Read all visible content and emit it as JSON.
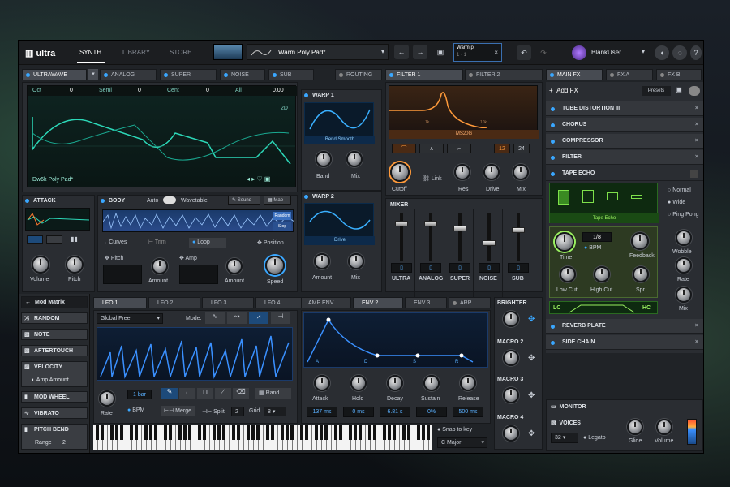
{
  "top": {
    "nav": [
      "SYNTH",
      "LIBRARY",
      "STORE"
    ],
    "preset": "Warm Poly Pad*",
    "ab_line1": "Warm p",
    "ab_line2": "1 · 1",
    "ab_close": "×",
    "user": "BlankUser"
  },
  "osc": {
    "tabs": [
      "ULTRAWAVE",
      "ANALOG",
      "SUPER",
      "NOISE",
      "SUB"
    ],
    "routing": "ROUTING",
    "params": [
      {
        "name": "Oct",
        "value": "0"
      },
      {
        "name": "Semi",
        "value": "0"
      },
      {
        "name": "Cent",
        "value": "0"
      },
      {
        "name": "All",
        "value": "0.00"
      }
    ],
    "mode": "2D",
    "table": "Dw6k Poly Pad*"
  },
  "warp1": {
    "title": "WARP 1",
    "mode": "Bend Smooth",
    "knobs": [
      "Band",
      "Mix"
    ]
  },
  "warp2": {
    "title": "WARP 2",
    "mode": "Drive",
    "knobs": [
      "Amount",
      "Mix"
    ]
  },
  "attack": {
    "title": "ATTACK",
    "knobs": [
      "Volume",
      "Pitch"
    ]
  },
  "body": {
    "title": "BODY",
    "auto": "Auto",
    "wavetable": "Wavetable",
    "sound": "Sound",
    "map": "Map",
    "tabs": [
      "Curves",
      "Trim",
      "Loop"
    ],
    "position": "Position",
    "pitch": "Pitch",
    "amp": "Amp",
    "amount1": "Amount",
    "amount2": "Amount",
    "speed": "Speed",
    "random": "Random",
    "stop": "Stop"
  },
  "filter": {
    "tabs": [
      "FILTER 1",
      "FILTER 2"
    ],
    "type": "MS20G",
    "hz1": "1k",
    "hz2": "10k",
    "v1": "12",
    "v2": "24",
    "link": "Link",
    "knobs": [
      "Cutoff",
      "Res",
      "Drive",
      "Mix"
    ]
  },
  "mixer": {
    "title": "MIXER",
    "channels": [
      "ULTRA",
      "ANALOG",
      "SUPER",
      "NOISE",
      "SUB"
    ]
  },
  "fx": {
    "tabs": [
      "MAIN FX",
      "FX A",
      "FX B"
    ],
    "add": "Add FX",
    "presets": "Presets",
    "items": [
      "TUBE DISTORTION III",
      "CHORUS",
      "COMPRESSOR",
      "FILTER",
      "TAPE ECHO"
    ],
    "echo": {
      "mode": "Tape Echo",
      "modes": [
        "Normal",
        "Wide",
        "Ping Pong"
      ],
      "time": "Time",
      "time_val": "1/8",
      "bpm": "BPM",
      "feedback": "Feedback",
      "wobble": "Wobble",
      "rate": "Rate",
      "lowcut": "Low Cut",
      "highcut": "High Cut",
      "spr": "Spr",
      "mix": "Mix",
      "lc": "LC",
      "hc": "HC"
    },
    "bottom": [
      "REVERB PLATE",
      "SIDE CHAIN"
    ]
  },
  "mod": {
    "title": "Mod Matrix",
    "items": [
      "RANDOM",
      "NOTE",
      "AFTERTOUCH",
      "VELOCITY",
      "MOD WHEEL",
      "VIBRATO",
      "PITCH BEND"
    ],
    "amp_amount": "Amp Amount",
    "range": "Range",
    "range_val": "2"
  },
  "lfo": {
    "tabs": [
      "LFO 1",
      "LFO 2",
      "LFO 3",
      "LFO 4"
    ],
    "sync": "Global Free",
    "mode": "Mode:",
    "rate": "Rate",
    "rate_val": "1 bar",
    "bpm": "BPM",
    "merge": "Merge",
    "split": "Split",
    "split_val": "2",
    "grid": "Grid",
    "grid_val": "8",
    "rand": "Rand"
  },
  "env": {
    "tabs": [
      "AMP ENV",
      "ENV 2",
      "ENV 3",
      "ARP"
    ],
    "points": [
      "A",
      "D",
      "S",
      "R"
    ],
    "knobs": [
      "Attack",
      "Hold",
      "Decay",
      "Sustain",
      "Release"
    ],
    "values": [
      "137 ms",
      "0 ms",
      "6.81 s",
      "0%",
      "500 ms"
    ]
  },
  "macros": [
    "BRIGHTER",
    "MACRO 2",
    "MACRO 3",
    "MACRO 4"
  ],
  "keys": {
    "snap": "Snap to key",
    "scale": "C Major"
  },
  "monitor": {
    "title": "MONITOR",
    "voices": "VOICES",
    "voices_val": "32",
    "legato": "Legato",
    "glide": "Glide",
    "volume": "Volume"
  }
}
